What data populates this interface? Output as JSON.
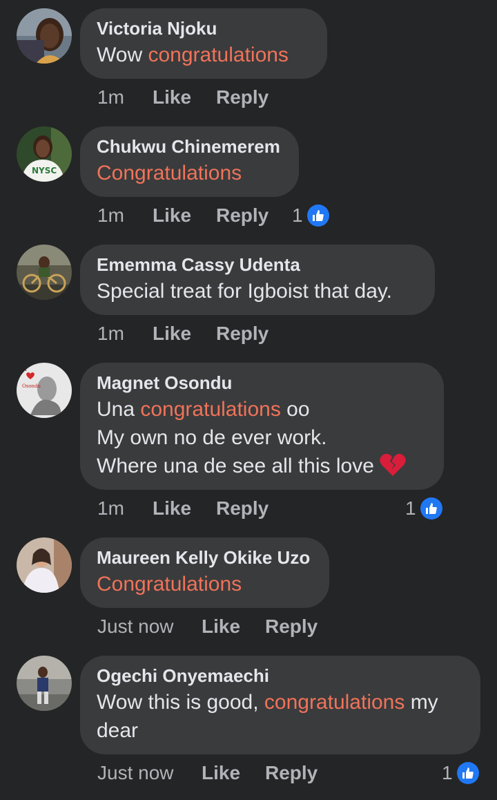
{
  "comments": [
    {
      "author": "Victoria Njoku",
      "text_plain": "Wow ",
      "text_highlight": "congratulations",
      "time": "1m",
      "like_label": "Like",
      "reply_label": "Reply"
    },
    {
      "author": "Chukwu Chinemerem",
      "text_highlight": "Congratulations",
      "time": "1m",
      "like_label": "Like",
      "reply_label": "Reply",
      "reaction_count": "1"
    },
    {
      "author": "Ememma Cassy Udenta",
      "text_plain": "Special treat for Igboist that day.",
      "time": "1m",
      "like_label": "Like",
      "reply_label": "Reply"
    },
    {
      "author": "Magnet Osondu",
      "line1_plain_a": "Una ",
      "line1_highlight": "congratulations",
      "line1_plain_b": " oo",
      "line2": "My own no de ever work.",
      "line3": "Where una de see all this love",
      "time": "1m",
      "like_label": "Like",
      "reply_label": "Reply",
      "reaction_count": "1"
    },
    {
      "author": "Maureen Kelly Okike Uzo",
      "text_highlight": "Congratulations",
      "time": "Just now",
      "like_label": "Like",
      "reply_label": "Reply"
    },
    {
      "author": "Ogechi Onyemaechi",
      "line1_plain_a": "Wow this is good, ",
      "line1_highlight": "congratulations",
      "line1_plain_b": " my",
      "line2": "dear",
      "time": "Just now",
      "like_label": "Like",
      "reply_label": "Reply",
      "reaction_count": "1"
    }
  ],
  "colors": {
    "background": "#242526",
    "bubble": "#3a3b3c",
    "highlight": "#f0735a",
    "like_blue": "#2078f4",
    "meta_text": "#b0b3b8"
  },
  "icons": [
    "like-thumb-icon",
    "broken-heart-icon"
  ]
}
